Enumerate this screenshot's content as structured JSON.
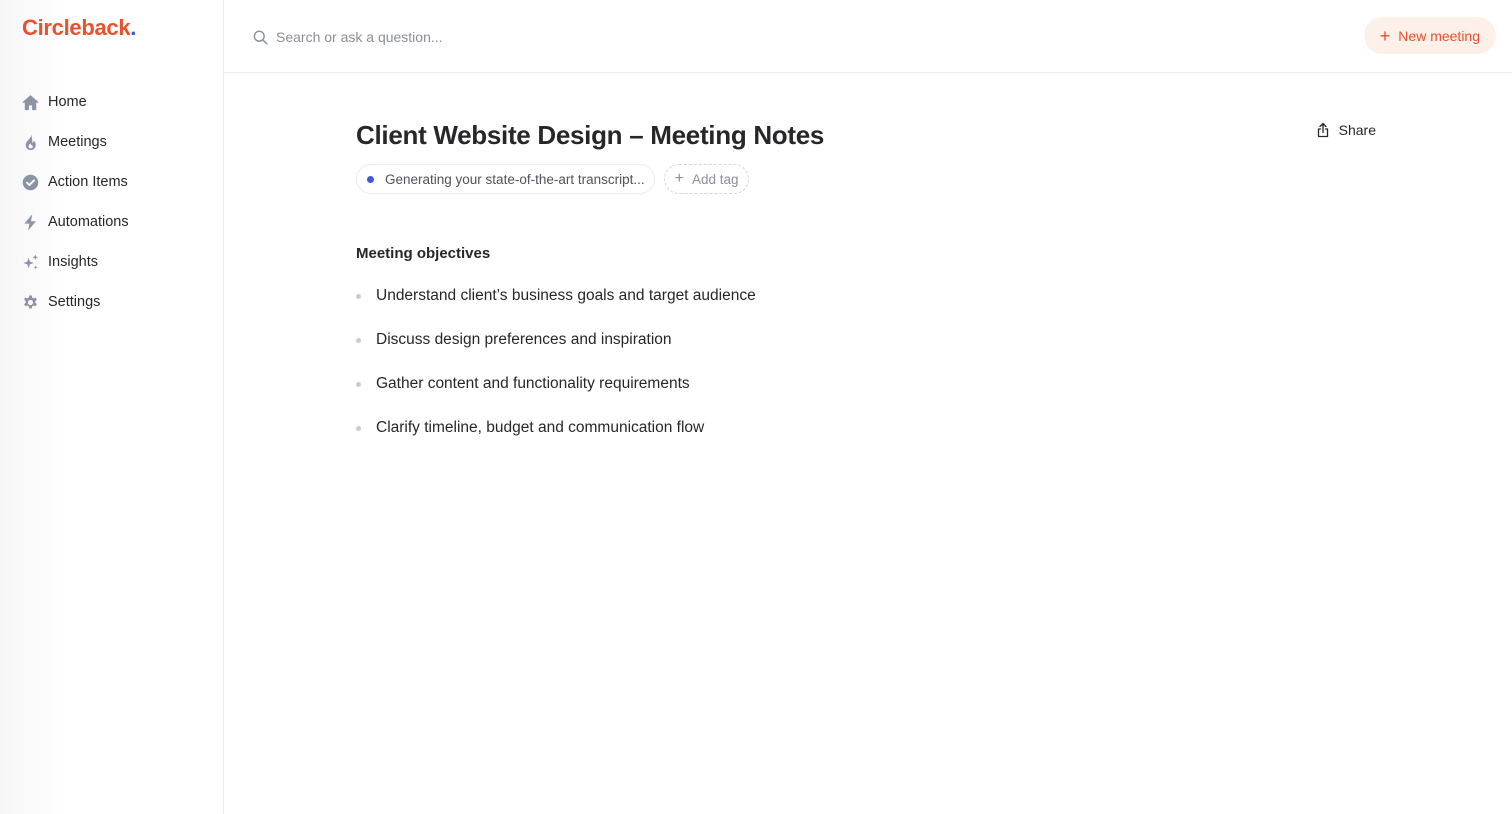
{
  "brand": {
    "name": "Circleback",
    "dot": ".",
    "color": "#e8502e",
    "dot_color": "#3b5bdb"
  },
  "sidebar": {
    "items": [
      {
        "label": "Home",
        "icon": "home-icon"
      },
      {
        "label": "Meetings",
        "icon": "flame-icon"
      },
      {
        "label": "Action Items",
        "icon": "check-circle-icon"
      },
      {
        "label": "Automations",
        "icon": "bolt-icon"
      },
      {
        "label": "Insights",
        "icon": "sparkles-icon"
      },
      {
        "label": "Settings",
        "icon": "gear-icon"
      }
    ]
  },
  "search": {
    "placeholder": "Search or ask a question..."
  },
  "header": {
    "new_meeting_label": "New meeting",
    "accent": "#e8502e"
  },
  "meeting": {
    "title": "Client Website Design – Meeting Notes",
    "share_label": "Share",
    "status_text": "Generating your state-of-the-art transcript...",
    "add_tag_label": "Add tag",
    "section_heading": "Meeting objectives",
    "objectives": [
      "Understand client’s business goals and target audience",
      "Discuss design preferences and inspiration",
      "Gather content and functionality requirements",
      "Clarify timeline, budget and communication flow"
    ]
  }
}
